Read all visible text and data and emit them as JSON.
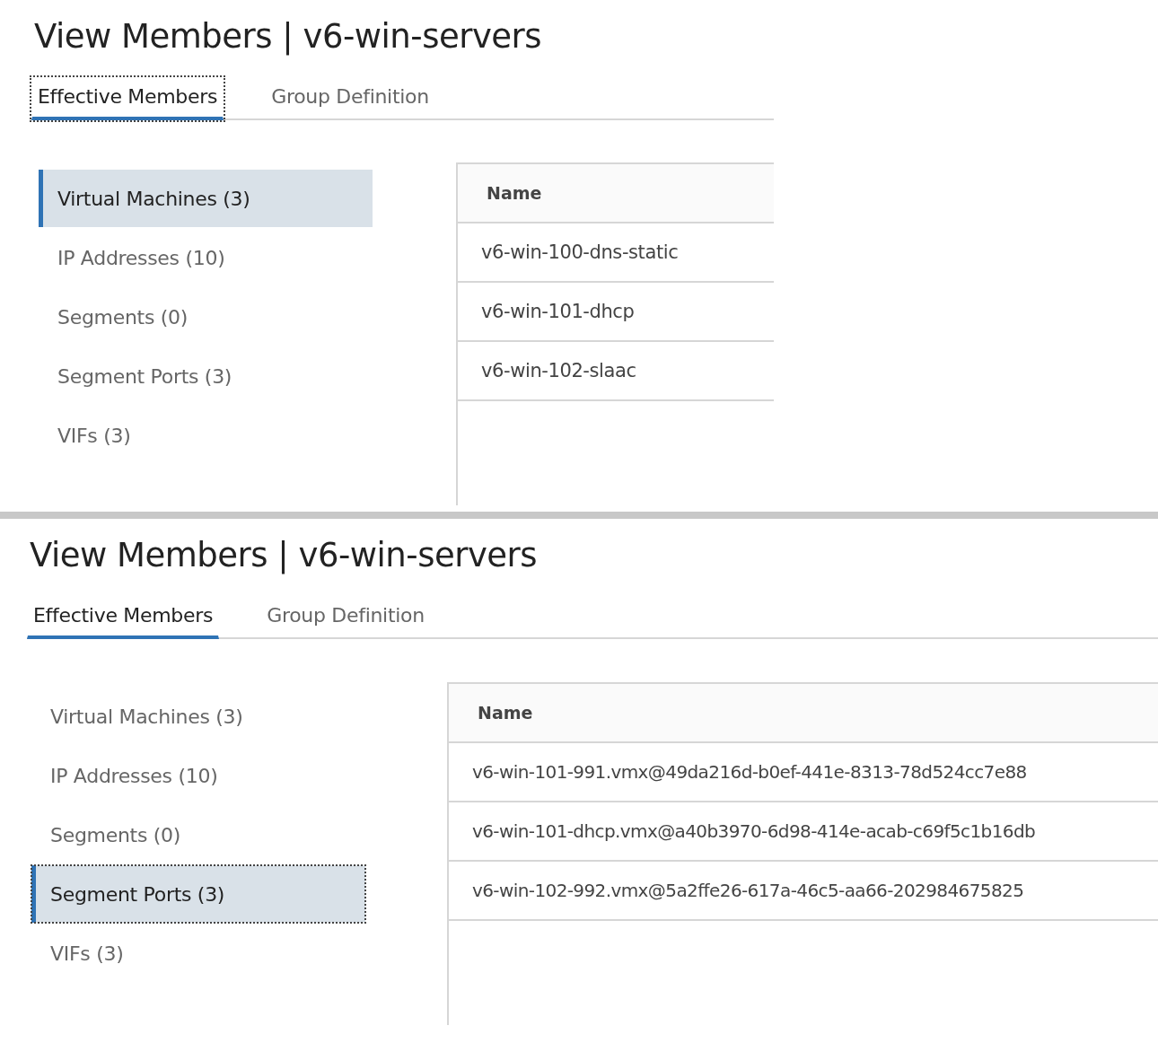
{
  "panels": [
    {
      "title": "View Members | v6-win-servers",
      "full_width": false,
      "tabs": [
        {
          "label": "Effective Members",
          "selected": true,
          "focused": true
        },
        {
          "label": "Group Definition",
          "selected": false,
          "focused": false
        }
      ],
      "categories": [
        {
          "label": "Virtual Machines (3)",
          "selected": true,
          "focused": false
        },
        {
          "label": "IP Addresses (10)",
          "selected": false,
          "focused": false
        },
        {
          "label": "Segments (0)",
          "selected": false,
          "focused": false
        },
        {
          "label": "Segment Ports (3)",
          "selected": false,
          "focused": false
        },
        {
          "label": "VIFs (3)",
          "selected": false,
          "focused": false
        }
      ],
      "table": {
        "columns": [
          "Name"
        ],
        "rows": [
          "v6-win-100-dns-static",
          "v6-win-101-dhcp",
          "v6-win-102-slaac"
        ]
      }
    },
    {
      "title": "View Members | v6-win-servers",
      "full_width": true,
      "tabs": [
        {
          "label": "Effective Members",
          "selected": true,
          "focused": false
        },
        {
          "label": "Group Definition",
          "selected": false,
          "focused": false
        }
      ],
      "categories": [
        {
          "label": "Virtual Machines (3)",
          "selected": false,
          "focused": false
        },
        {
          "label": "IP Addresses (10)",
          "selected": false,
          "focused": false
        },
        {
          "label": "Segments (0)",
          "selected": false,
          "focused": false
        },
        {
          "label": "Segment Ports (3)",
          "selected": true,
          "focused": true
        },
        {
          "label": "VIFs (3)",
          "selected": false,
          "focused": false
        }
      ],
      "table": {
        "columns": [
          "Name"
        ],
        "rows": [
          "v6-win-101-991.vmx@49da216d-b0ef-441e-8313-78d524cc7e88",
          "v6-win-101-dhcp.vmx@a40b3970-6d98-414e-acab-c69f5c1b16db",
          "v6-win-102-992.vmx@5a2ffe26-617a-46c5-aa66-202984675825"
        ]
      }
    }
  ]
}
